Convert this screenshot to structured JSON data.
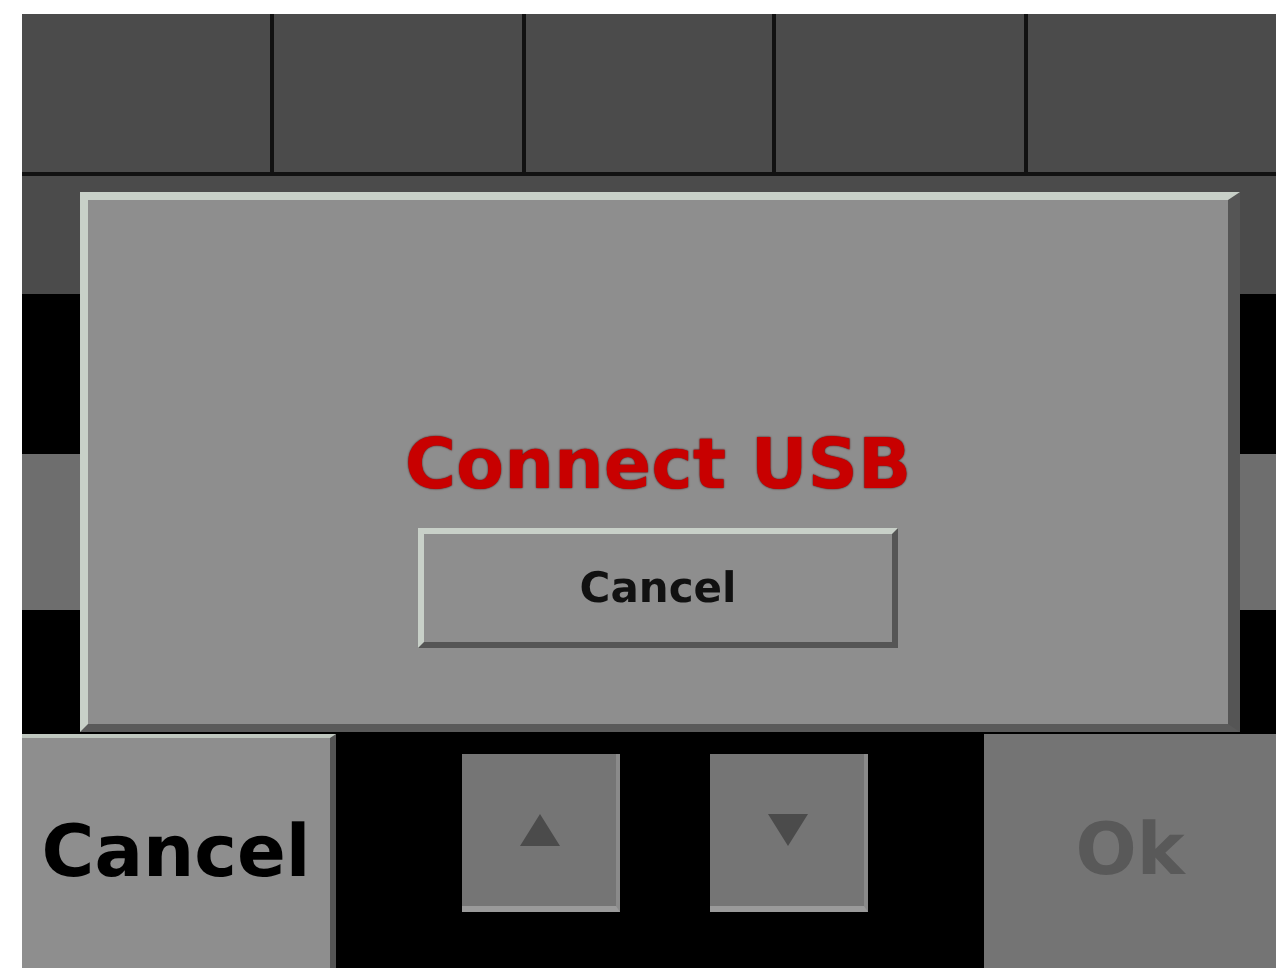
{
  "dialog": {
    "message": "Connect USB",
    "button": "Cancel"
  },
  "bottom_bar": [
    {
      "kind": "text",
      "label": "Cancel",
      "disabled": false
    },
    {
      "kind": "up",
      "disabled": false
    },
    {
      "kind": "down",
      "disabled": false
    },
    {
      "kind": "text",
      "label": "Ok",
      "disabled": true
    }
  ]
}
